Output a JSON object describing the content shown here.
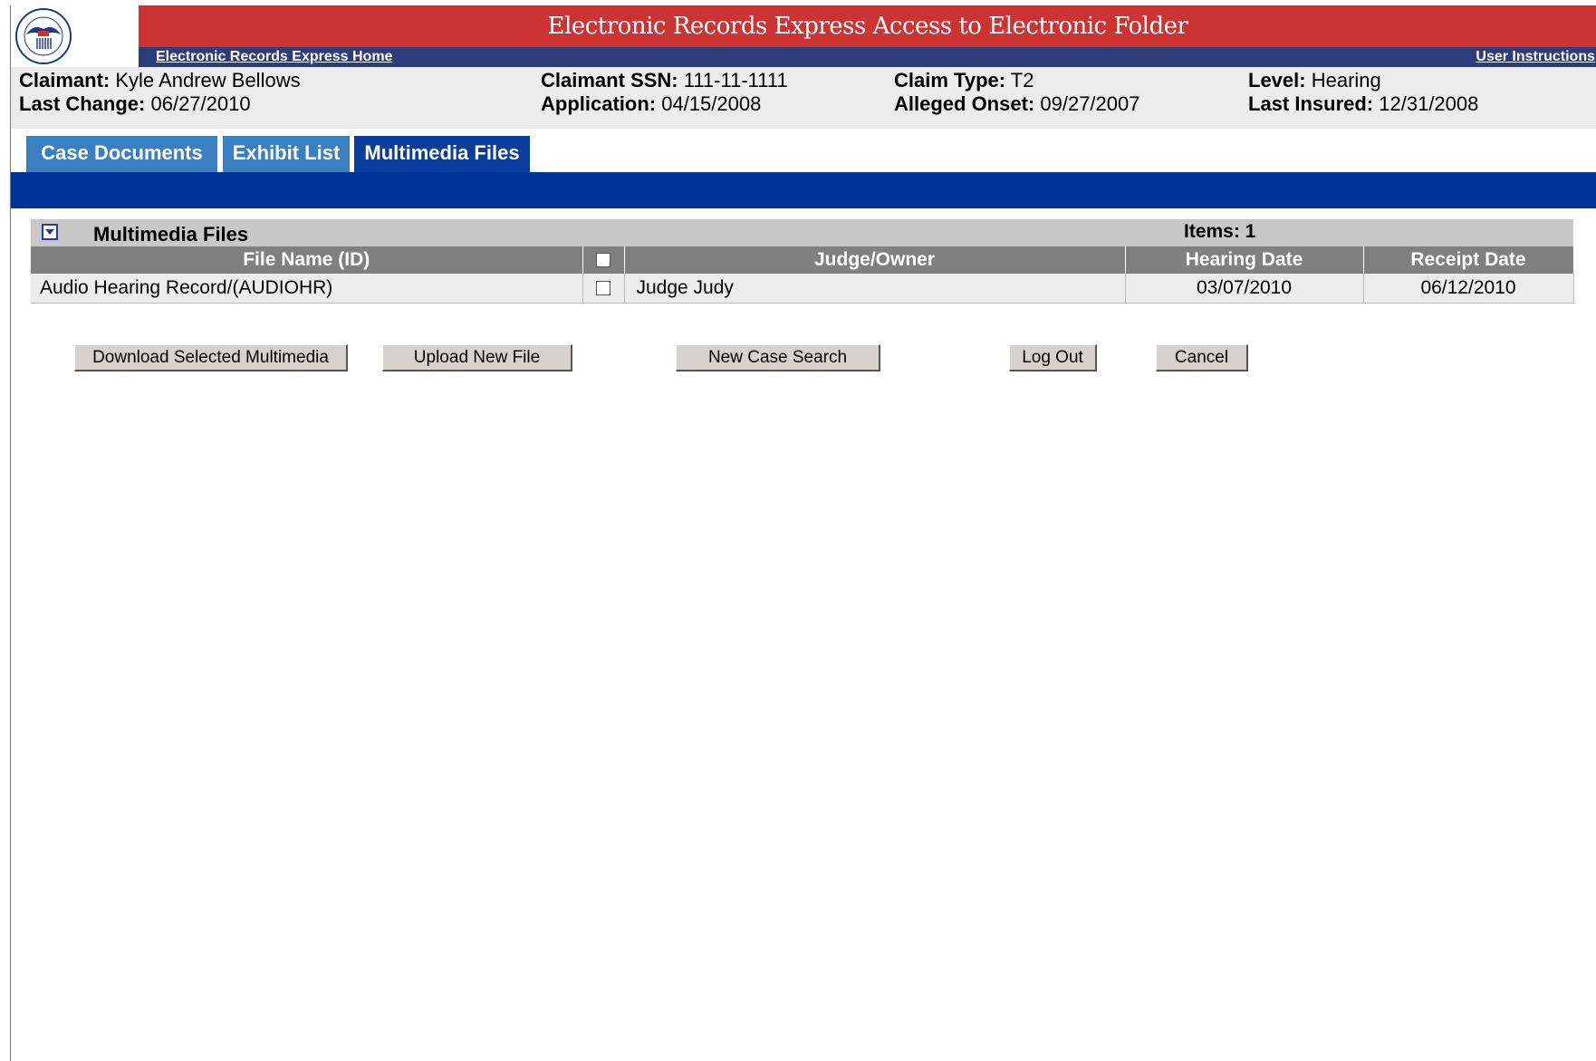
{
  "header": {
    "title": "Electronic Records Express Access to Electronic Folder",
    "home_link": "Electronic Records Express Home",
    "help_link": "User Instructions",
    "logo_text": "SOCIAL SECURITY ADMINISTRATION USA",
    "colors": {
      "title_bar": "#cc3333",
      "nav_bar": "#2d3d7a"
    }
  },
  "claim_info": {
    "claimant_label": "Claimant:",
    "claimant": "Kyle Andrew Bellows",
    "last_change_label": "Last Change:",
    "last_change": "06/27/2010",
    "ssn_label": "Claimant SSN:",
    "ssn": "111-11-1111",
    "application_label": "Application:",
    "application": "04/15/2008",
    "claim_type_label": "Claim Type:",
    "claim_type": "T2",
    "alleged_onset_label": "Alleged Onset:",
    "alleged_onset": "09/27/2007",
    "level_label": "Level:",
    "level": "Hearing",
    "last_insured_label": "Last Insured:",
    "last_insured": "12/31/2008"
  },
  "tabs": [
    {
      "label": "Case Documents",
      "active": false
    },
    {
      "label": "Exhibit List",
      "active": false
    },
    {
      "label": "Multimedia Files",
      "active": true
    }
  ],
  "panel": {
    "title": "Multimedia Files",
    "items_label": "Items: 1",
    "columns": [
      "File Name  (ID)",
      "Judge/Owner",
      "Hearing Date",
      "Receipt Date"
    ],
    "rows": [
      {
        "file_name": "Audio Hearing Record/(AUDIOHR)",
        "checked": false,
        "judge": "Judge Judy",
        "hearing_date": "03/07/2010",
        "receipt_date": "06/12/2010"
      }
    ]
  },
  "buttons": {
    "download": "Download Selected Multimedia",
    "upload": "Upload New File",
    "new_search": "New Case Search",
    "logout": "Log Out",
    "cancel": "Cancel"
  }
}
